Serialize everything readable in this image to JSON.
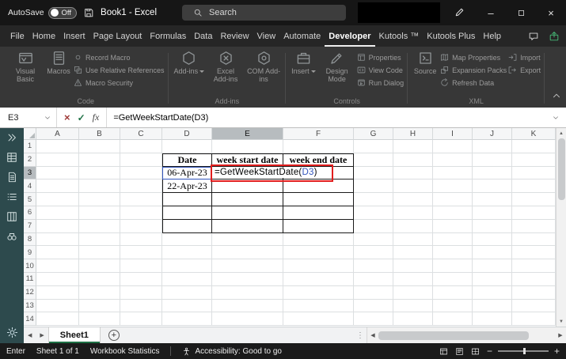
{
  "titlebar": {
    "autosave_label": "AutoSave",
    "autosave_state": "Off",
    "title": "Book1 - Excel",
    "search_placeholder": "Search"
  },
  "glyphs": {
    "close": "×",
    "minimize": "–",
    "prev": "◀",
    "next": "▶",
    "up": "▲",
    "down": "▼",
    "splitter": "⋮",
    "add_sheet": "+",
    "zoom_out": "−",
    "zoom_in": "+"
  },
  "ribbon_tabs": {
    "items": [
      "File",
      "Home",
      "Insert",
      "Page Layout",
      "Formulas",
      "Data",
      "Review",
      "View",
      "Automate",
      "Developer",
      "Kutools ™",
      "Kutools Plus",
      "Help"
    ],
    "active": "Developer"
  },
  "ribbon": {
    "groups": [
      {
        "name": "Code",
        "big": [
          {
            "label": "Visual Basic",
            "icon": "vb-window-icon"
          },
          {
            "label": "Macros",
            "icon": "macros-icon"
          }
        ],
        "stacks": [
          [
            {
              "label": "Record Macro",
              "icon": "record-macro-icon"
            },
            {
              "label": "Use Relative References",
              "icon": "relative-references-icon"
            },
            {
              "label": "Macro Security",
              "icon": "macro-security-icon"
            }
          ]
        ]
      },
      {
        "name": "Add-ins",
        "big": [
          {
            "label": "Add-ins",
            "icon": "addin-hexagon-icon",
            "dropdown": true
          },
          {
            "label": "Excel Add-ins",
            "icon": "excel-addin-icon"
          },
          {
            "label": "COM Add-ins",
            "icon": "com-addin-icon"
          }
        ],
        "stacks": []
      },
      {
        "name": "Controls",
        "big": [
          {
            "label": "Insert",
            "icon": "insert-toolbox-icon",
            "dropdown": true
          },
          {
            "label": "Design Mode",
            "icon": "design-mode-icon"
          }
        ],
        "stacks": [
          [
            {
              "label": "Properties",
              "icon": "properties-icon"
            },
            {
              "label": "View Code",
              "icon": "view-code-icon"
            },
            {
              "label": "Run Dialog",
              "icon": "run-dialog-icon"
            }
          ]
        ]
      },
      {
        "name": "XML",
        "big": [
          {
            "label": "Source",
            "icon": "source-icon"
          }
        ],
        "stacks": [
          [
            {
              "label": "Map Properties",
              "icon": "map-properties-icon"
            },
            {
              "label": "Expansion Packs",
              "icon": "expansion-packs-icon"
            },
            {
              "label": "Refresh Data",
              "icon": "refresh-data-icon"
            }
          ],
          [
            {
              "label": "Import",
              "icon": "import-icon"
            },
            {
              "label": "Export",
              "icon": "export-icon"
            }
          ]
        ]
      }
    ]
  },
  "formula_bar": {
    "name_box": "E3",
    "cancel_glyph": "×",
    "enter_glyph": "✓",
    "fx_label": "fx",
    "formula": "=GetWeekStartDate(D3)"
  },
  "kutools_sidebar": {
    "icons": [
      "chevrons-right-icon",
      "view-grid-icon",
      "sheet-icon",
      "list-icon",
      "columns-icon",
      "binoculars-icon"
    ],
    "settings_icon": "gear-icon"
  },
  "grid": {
    "columns": [
      "A",
      "B",
      "C",
      "D",
      "E",
      "F",
      "G",
      "H",
      "I",
      "J",
      "K"
    ],
    "row_count": 14,
    "selected_column": "E",
    "selected_row": 3,
    "cells": [
      {
        "ref": "D2",
        "text": "Date",
        "bold": true
      },
      {
        "ref": "E2",
        "text": "week start date",
        "bold": true
      },
      {
        "ref": "F2",
        "text": "week end date",
        "bold": true
      },
      {
        "ref": "D3",
        "text": "06-Apr-23"
      },
      {
        "ref": "D4",
        "text": "22-Apr-23"
      }
    ],
    "edit_cell": {
      "ref": "E3",
      "formula_prefix": "=GetWeekStartDate(",
      "formula_ref": "D3",
      "formula_suffix": ")"
    },
    "table": {
      "first_col": "D",
      "last_col": "F",
      "first_row": 2,
      "last_row": 7
    },
    "reference_highlight": "D3"
  },
  "sheet_tabs": {
    "tabs": [
      {
        "label": "Sheet1",
        "active": true
      }
    ]
  },
  "status_bar": {
    "mode": "Enter",
    "sheet_info": "Sheet 1 of 1",
    "workbook_statistics": "Workbook Statistics",
    "accessibility": "Accessibility: Good to go"
  },
  "ui_icons": [
    "save-icon",
    "search-icon",
    "pen-icon",
    "maximize-icon",
    "comments-icon",
    "share-icon",
    "collapse-ribbon-icon",
    "namebox-chevron-icon",
    "formulabar-chevron-icon",
    "view-normal-icon",
    "view-page-layout-icon",
    "view-page-break-icon",
    "accessibility-icon",
    "gear-icon",
    "select-all-corner"
  ],
  "colors": {
    "accent_green": "#1e7145",
    "annotation_red": "#e11d1d",
    "reference_blue": "#3355bb",
    "titlebar_bg": "#161616",
    "ribbon_bg": "#373737",
    "sidebar_bg": "#2d4a4d"
  }
}
